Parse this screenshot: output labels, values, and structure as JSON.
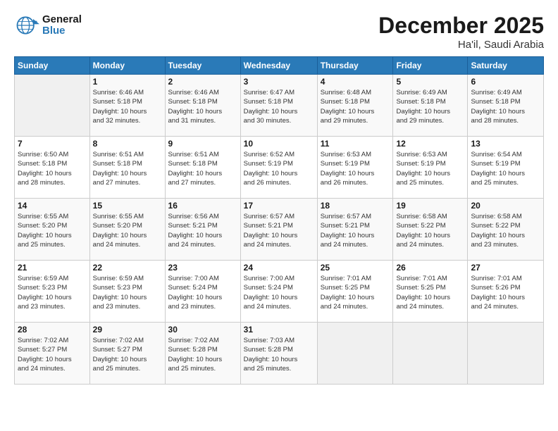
{
  "logo": {
    "general": "General",
    "blue": "Blue"
  },
  "title": "December 2025",
  "subtitle": "Ha'il, Saudi Arabia",
  "days_header": [
    "Sunday",
    "Monday",
    "Tuesday",
    "Wednesday",
    "Thursday",
    "Friday",
    "Saturday"
  ],
  "weeks": [
    [
      {
        "day": "",
        "info": ""
      },
      {
        "day": "1",
        "info": "Sunrise: 6:46 AM\nSunset: 5:18 PM\nDaylight: 10 hours\nand 32 minutes."
      },
      {
        "day": "2",
        "info": "Sunrise: 6:46 AM\nSunset: 5:18 PM\nDaylight: 10 hours\nand 31 minutes."
      },
      {
        "day": "3",
        "info": "Sunrise: 6:47 AM\nSunset: 5:18 PM\nDaylight: 10 hours\nand 30 minutes."
      },
      {
        "day": "4",
        "info": "Sunrise: 6:48 AM\nSunset: 5:18 PM\nDaylight: 10 hours\nand 29 minutes."
      },
      {
        "day": "5",
        "info": "Sunrise: 6:49 AM\nSunset: 5:18 PM\nDaylight: 10 hours\nand 29 minutes."
      },
      {
        "day": "6",
        "info": "Sunrise: 6:49 AM\nSunset: 5:18 PM\nDaylight: 10 hours\nand 28 minutes."
      }
    ],
    [
      {
        "day": "7",
        "info": "Sunrise: 6:50 AM\nSunset: 5:18 PM\nDaylight: 10 hours\nand 28 minutes."
      },
      {
        "day": "8",
        "info": "Sunrise: 6:51 AM\nSunset: 5:18 PM\nDaylight: 10 hours\nand 27 minutes."
      },
      {
        "day": "9",
        "info": "Sunrise: 6:51 AM\nSunset: 5:18 PM\nDaylight: 10 hours\nand 27 minutes."
      },
      {
        "day": "10",
        "info": "Sunrise: 6:52 AM\nSunset: 5:19 PM\nDaylight: 10 hours\nand 26 minutes."
      },
      {
        "day": "11",
        "info": "Sunrise: 6:53 AM\nSunset: 5:19 PM\nDaylight: 10 hours\nand 26 minutes."
      },
      {
        "day": "12",
        "info": "Sunrise: 6:53 AM\nSunset: 5:19 PM\nDaylight: 10 hours\nand 25 minutes."
      },
      {
        "day": "13",
        "info": "Sunrise: 6:54 AM\nSunset: 5:19 PM\nDaylight: 10 hours\nand 25 minutes."
      }
    ],
    [
      {
        "day": "14",
        "info": "Sunrise: 6:55 AM\nSunset: 5:20 PM\nDaylight: 10 hours\nand 25 minutes."
      },
      {
        "day": "15",
        "info": "Sunrise: 6:55 AM\nSunset: 5:20 PM\nDaylight: 10 hours\nand 24 minutes."
      },
      {
        "day": "16",
        "info": "Sunrise: 6:56 AM\nSunset: 5:21 PM\nDaylight: 10 hours\nand 24 minutes."
      },
      {
        "day": "17",
        "info": "Sunrise: 6:57 AM\nSunset: 5:21 PM\nDaylight: 10 hours\nand 24 minutes."
      },
      {
        "day": "18",
        "info": "Sunrise: 6:57 AM\nSunset: 5:21 PM\nDaylight: 10 hours\nand 24 minutes."
      },
      {
        "day": "19",
        "info": "Sunrise: 6:58 AM\nSunset: 5:22 PM\nDaylight: 10 hours\nand 24 minutes."
      },
      {
        "day": "20",
        "info": "Sunrise: 6:58 AM\nSunset: 5:22 PM\nDaylight: 10 hours\nand 23 minutes."
      }
    ],
    [
      {
        "day": "21",
        "info": "Sunrise: 6:59 AM\nSunset: 5:23 PM\nDaylight: 10 hours\nand 23 minutes."
      },
      {
        "day": "22",
        "info": "Sunrise: 6:59 AM\nSunset: 5:23 PM\nDaylight: 10 hours\nand 23 minutes."
      },
      {
        "day": "23",
        "info": "Sunrise: 7:00 AM\nSunset: 5:24 PM\nDaylight: 10 hours\nand 23 minutes."
      },
      {
        "day": "24",
        "info": "Sunrise: 7:00 AM\nSunset: 5:24 PM\nDaylight: 10 hours\nand 24 minutes."
      },
      {
        "day": "25",
        "info": "Sunrise: 7:01 AM\nSunset: 5:25 PM\nDaylight: 10 hours\nand 24 minutes."
      },
      {
        "day": "26",
        "info": "Sunrise: 7:01 AM\nSunset: 5:25 PM\nDaylight: 10 hours\nand 24 minutes."
      },
      {
        "day": "27",
        "info": "Sunrise: 7:01 AM\nSunset: 5:26 PM\nDaylight: 10 hours\nand 24 minutes."
      }
    ],
    [
      {
        "day": "28",
        "info": "Sunrise: 7:02 AM\nSunset: 5:27 PM\nDaylight: 10 hours\nand 24 minutes."
      },
      {
        "day": "29",
        "info": "Sunrise: 7:02 AM\nSunset: 5:27 PM\nDaylight: 10 hours\nand 25 minutes."
      },
      {
        "day": "30",
        "info": "Sunrise: 7:02 AM\nSunset: 5:28 PM\nDaylight: 10 hours\nand 25 minutes."
      },
      {
        "day": "31",
        "info": "Sunrise: 7:03 AM\nSunset: 5:28 PM\nDaylight: 10 hours\nand 25 minutes."
      },
      {
        "day": "",
        "info": ""
      },
      {
        "day": "",
        "info": ""
      },
      {
        "day": "",
        "info": ""
      }
    ]
  ]
}
